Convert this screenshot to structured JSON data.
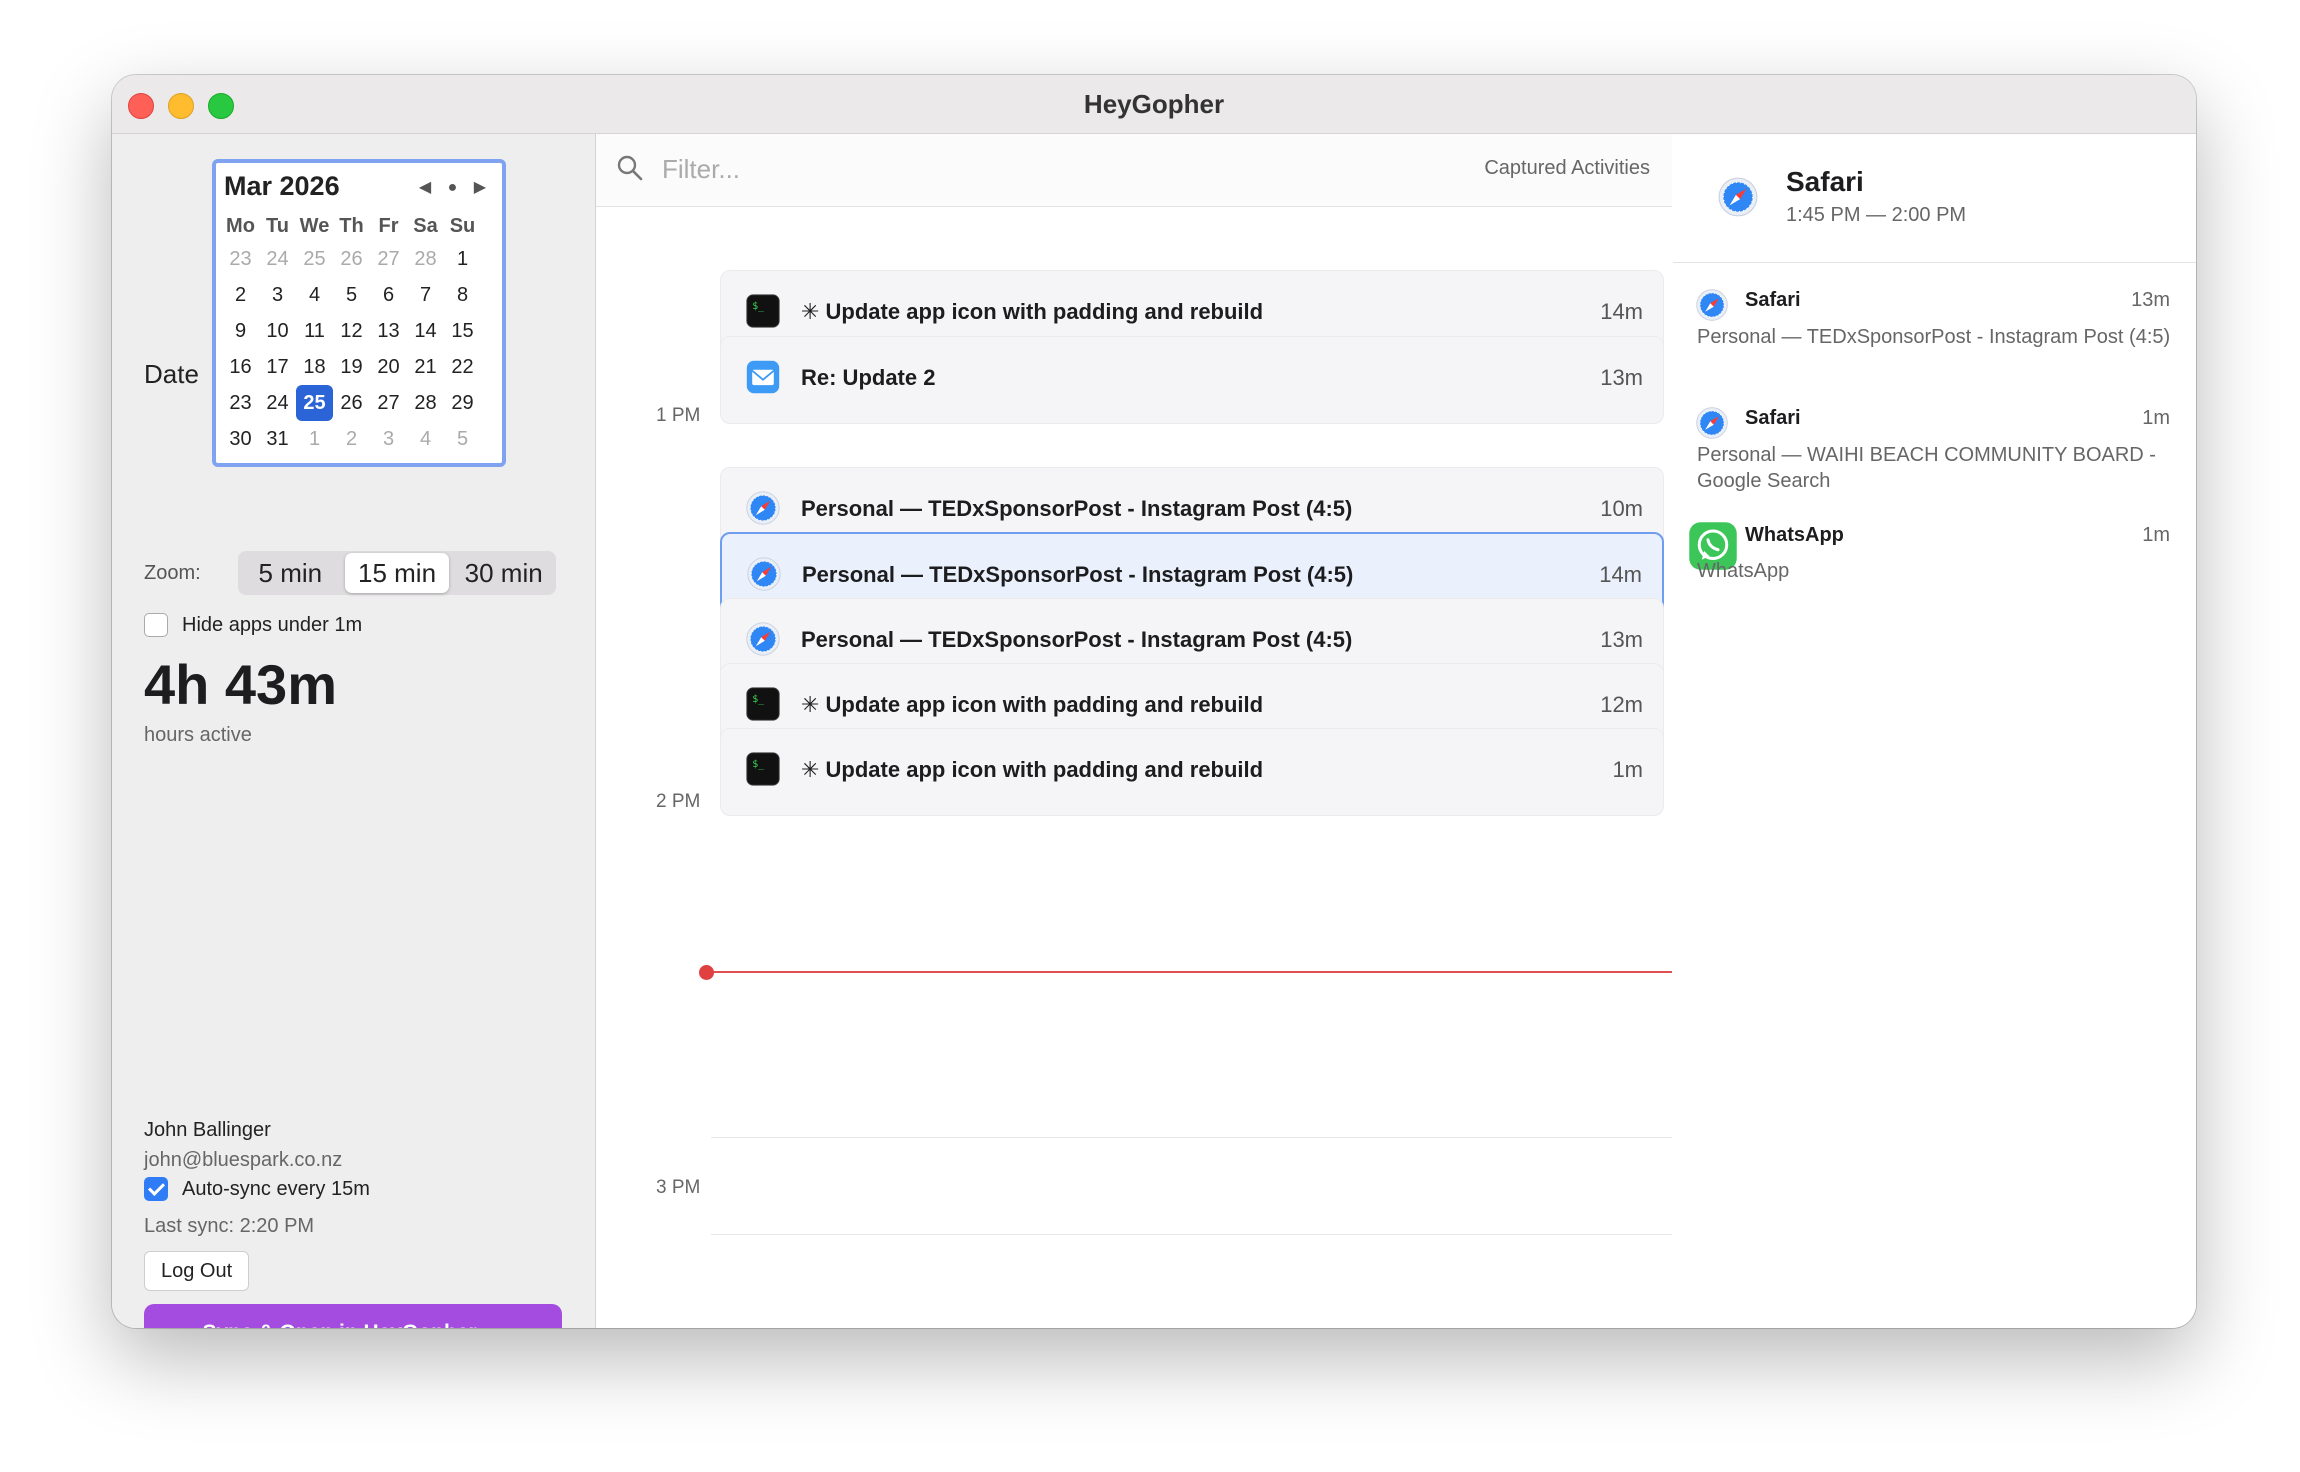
{
  "window": {
    "title": "HeyGopher"
  },
  "sidebar": {
    "date_label": "Date",
    "calendar": {
      "month_label": "Mar 2026",
      "nav": "◀ ● ▶",
      "weekdays": [
        "Mo",
        "Tu",
        "We",
        "Th",
        "Fr",
        "Sa",
        "Su"
      ],
      "days": [
        "23",
        "24",
        "25",
        "26",
        "27",
        "28",
        "1",
        "2",
        "3",
        "4",
        "5",
        "6",
        "7",
        "8",
        "9",
        "10",
        "11",
        "12",
        "13",
        "14",
        "15",
        "16",
        "17",
        "18",
        "19",
        "20",
        "21",
        "22",
        "23",
        "24",
        "25",
        "26",
        "27",
        "28",
        "29",
        "30",
        "31",
        "1",
        "2",
        "3",
        "4",
        "5"
      ],
      "selected_day": "25"
    },
    "zoom_label": "Zoom:",
    "zoom_options": [
      "5 min",
      "15 min",
      "30 min"
    ],
    "zoom_selected": "15 min",
    "hide_apps_label": "Hide apps under 1m",
    "total": "4h 43m",
    "total_label": "hours active",
    "user_name": "John Ballinger",
    "user_email": "john@bluespark.co.nz",
    "autosync_label": "Auto-sync every 15m",
    "last_sync": "Last sync: 2:20 PM",
    "logout_label": "Log Out",
    "sync_button": "Sync & Open in HeyGopher →"
  },
  "timeline": {
    "filter_placeholder": "Filter...",
    "captured_label": "Captured Activities",
    "hours": [
      "1 PM",
      "2 PM",
      "3 PM"
    ],
    "activities": [
      {
        "icon": "terminal-icon",
        "title": "✳ Update app icon with padding and rebuild",
        "duration": "14m"
      },
      {
        "icon": "mail-icon",
        "title": "Re: Update 2",
        "duration": "13m"
      },
      {
        "icon": "safari-icon",
        "title": "Personal — TEDxSponsorPost - Instagram Post (4:5)",
        "duration": "10m"
      },
      {
        "icon": "safari-icon",
        "title": "Personal — TEDxSponsorPost - Instagram Post (4:5)",
        "duration": "14m"
      },
      {
        "icon": "safari-icon",
        "title": "Personal — TEDxSponsorPost - Instagram Post (4:5)",
        "duration": "13m"
      },
      {
        "icon": "terminal-icon",
        "title": "✳ Update app icon with padding and rebuild",
        "duration": "12m"
      },
      {
        "icon": "terminal-icon",
        "title": "✳ Update app icon with padding and rebuild",
        "duration": "1m"
      }
    ]
  },
  "detail": {
    "app": "Safari",
    "time_range": "1:45 PM — 2:00 PM",
    "entries": [
      {
        "icon": "safari-icon",
        "app": "Safari",
        "duration": "13m",
        "desc": "Personal — TEDxSponsorPost - Instagram Post (4:5)"
      },
      {
        "icon": "safari-icon",
        "app": "Safari",
        "duration": "1m",
        "desc": "Personal — WAIHI BEACH COMMUNITY BOARD - Google Search"
      },
      {
        "icon": "whatsapp-icon",
        "app": "WhatsApp",
        "duration": "1m",
        "desc": "WhatsApp"
      }
    ]
  },
  "colors": {
    "accent": "#a44be0",
    "selection": "#2b64d6",
    "now_line": "#e05050"
  }
}
